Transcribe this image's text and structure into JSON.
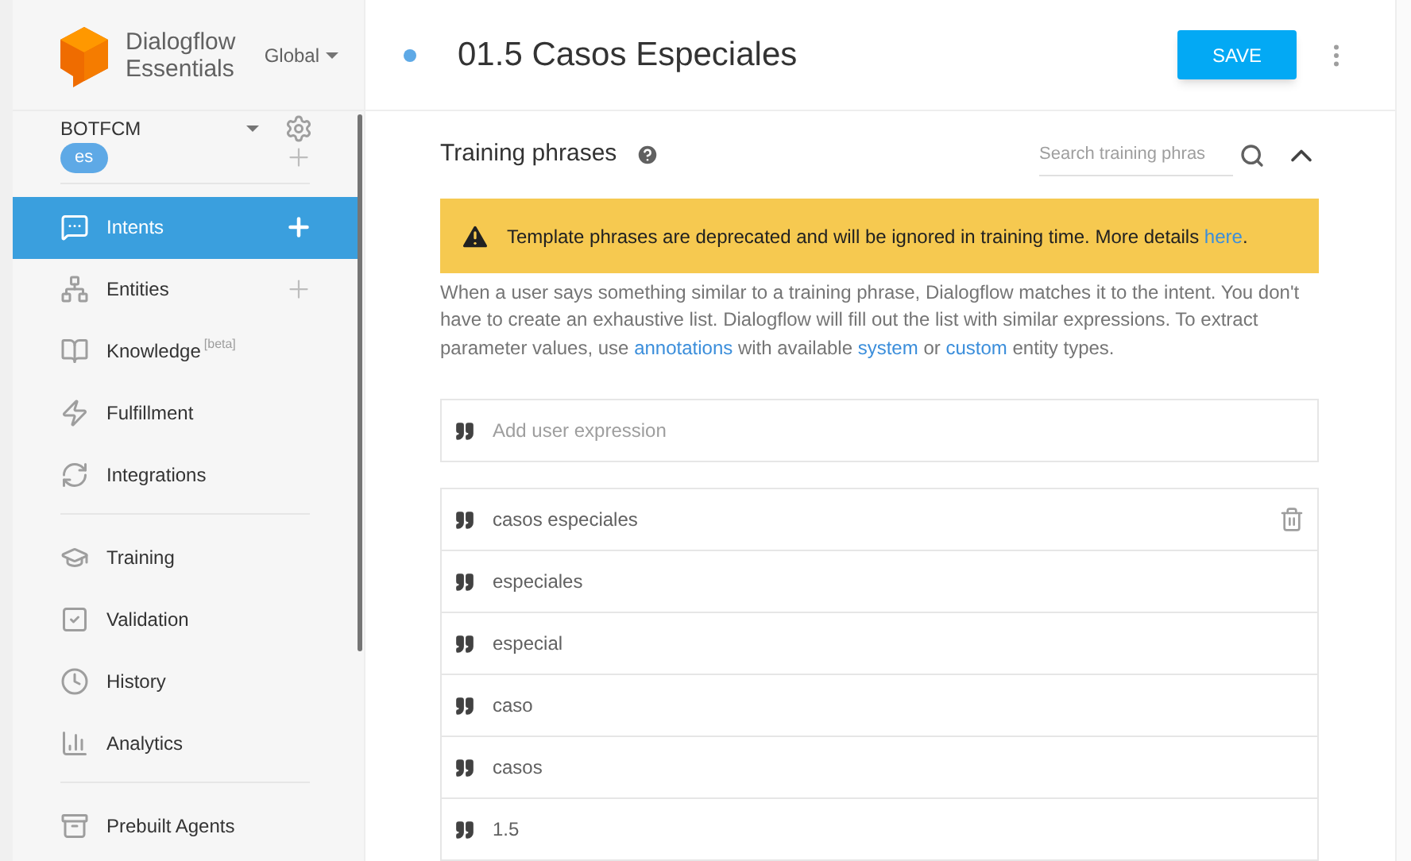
{
  "brand": {
    "line1": "Dialogflow",
    "line2": "Essentials",
    "region": "Global"
  },
  "agent": {
    "name": "BOTFCM",
    "language": "es"
  },
  "nav_groups": [
    [
      {
        "kind": "intents",
        "label": "Intents",
        "selected": true,
        "addable": true
      },
      {
        "kind": "entities",
        "label": "Entities",
        "selected": false,
        "addable": true
      },
      {
        "kind": "knowledge",
        "label": "Knowledge",
        "badge": "[beta]",
        "selected": false,
        "addable": false
      },
      {
        "kind": "fulfillment",
        "label": "Fulfillment",
        "selected": false,
        "addable": false
      },
      {
        "kind": "integrations",
        "label": "Integrations",
        "selected": false,
        "addable": false
      }
    ],
    [
      {
        "kind": "training",
        "label": "Training",
        "selected": false,
        "addable": false
      },
      {
        "kind": "validation",
        "label": "Validation",
        "selected": false,
        "addable": false
      },
      {
        "kind": "history",
        "label": "History",
        "selected": false,
        "addable": false
      },
      {
        "kind": "analytics",
        "label": "Analytics",
        "selected": false,
        "addable": false
      }
    ],
    [
      {
        "kind": "prebuilt",
        "label": "Prebuilt Agents",
        "selected": false,
        "addable": false
      }
    ]
  ],
  "intent": {
    "title": "01.5 Casos Especiales",
    "save": "SAVE"
  },
  "section": {
    "title": "Training phrases",
    "search_placeholder": "Search training phras",
    "expanded": true
  },
  "warning": [
    {
      "kind": "text",
      "text": "Template phrases are deprecated and will be ignored in training time. More details "
    },
    {
      "kind": "link",
      "text": "here"
    },
    {
      "kind": "text",
      "text": "."
    }
  ],
  "description": [
    {
      "kind": "text",
      "text": "When a user says something similar to a training phrase, Dialogflow matches it to the intent. You don't have to create an exhaustive list. Dialogflow will fill out the list with similar expressions. To extract parameter values, use "
    },
    {
      "kind": "link",
      "text": "annotations"
    },
    {
      "kind": "text",
      "text": " with available "
    },
    {
      "kind": "link",
      "text": "system"
    },
    {
      "kind": "text",
      "text": " or "
    },
    {
      "kind": "link",
      "text": "custom"
    },
    {
      "kind": "text",
      "text": " entity types."
    }
  ],
  "add_placeholder": "Add user expression",
  "phrases": [
    {
      "text": "casos especiales",
      "delete_visible": true
    },
    {
      "text": "especiales",
      "delete_visible": false
    },
    {
      "text": "especial",
      "delete_visible": false
    },
    {
      "text": "caso",
      "delete_visible": false
    },
    {
      "text": "casos",
      "delete_visible": false
    },
    {
      "text": "1.5",
      "delete_visible": false
    }
  ]
}
